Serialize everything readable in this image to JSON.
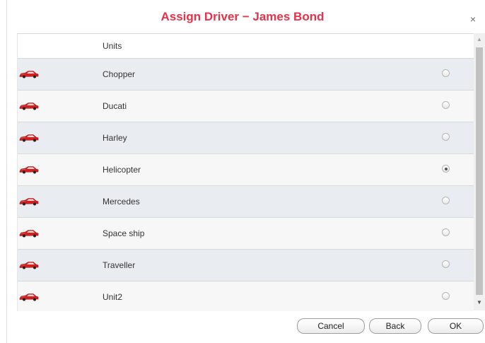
{
  "dialog": {
    "title": "Assign Driver − James Bond",
    "close_label": "×"
  },
  "list": {
    "header": "Units",
    "rows": [
      {
        "name": "Chopper",
        "selected": false,
        "icon": "red-car-icon"
      },
      {
        "name": "Ducati",
        "selected": false,
        "icon": "red-car-icon"
      },
      {
        "name": "Harley",
        "selected": false,
        "icon": "red-car-icon"
      },
      {
        "name": "Helicopter",
        "selected": true,
        "icon": "red-car-icon"
      },
      {
        "name": "Mercedes",
        "selected": false,
        "icon": "red-car-icon"
      },
      {
        "name": "Space ship",
        "selected": false,
        "icon": "red-car-icon"
      },
      {
        "name": "Traveller",
        "selected": false,
        "icon": "red-car-icon"
      },
      {
        "name": "Unit2",
        "selected": false,
        "icon": "red-car-icon"
      }
    ]
  },
  "buttons": {
    "cancel": "Cancel",
    "back": "Back",
    "ok": "OK"
  },
  "colors": {
    "title": "#e5334b",
    "row_odd": "#e9edf1",
    "row_even": "#f7f7f7"
  }
}
